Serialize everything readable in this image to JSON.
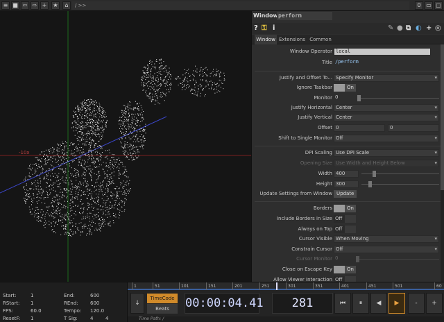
{
  "toolbar": {
    "path": "/ >>",
    "right_counter": "0"
  },
  "viewport": {
    "axis_label": "-10x",
    "colors": {
      "grid_red": "#8a2020",
      "grid_green": "#1d6b1d",
      "grid_blue": "#3b46c8"
    }
  },
  "panel": {
    "op_type": "Window",
    "op_name": "perform",
    "icons": [
      "help-icon",
      "python-help-icon",
      "info-icon",
      "pencil-icon",
      "comment-icon",
      "copy-icon",
      "refresh-icon",
      "plus-icon",
      "target-icon"
    ],
    "tabs": [
      "Window",
      "Extensions",
      "Common"
    ],
    "params": {
      "window_operator": {
        "label": "Window Operator",
        "value": "local"
      },
      "title": {
        "label": "Title",
        "value": "/perform"
      },
      "justify_offset": {
        "label": "Justify and Offset To...",
        "value": "Specify Monitor"
      },
      "ignore_taskbar": {
        "label": "Ignore Taskbar",
        "value": "On"
      },
      "monitor": {
        "label": "Monitor",
        "value": "0"
      },
      "justify_h": {
        "label": "Justify Horizontal",
        "value": "Center"
      },
      "justify_v": {
        "label": "Justify Vertical",
        "value": "Center"
      },
      "offset": {
        "label": "Offset",
        "value_x": "0",
        "value_y": "0"
      },
      "shift_single": {
        "label": "Shift to Single Monitor",
        "value": "Off"
      },
      "dpi_scaling": {
        "label": "DPI Scaling",
        "value": "Use DPI Scale"
      },
      "opening_size": {
        "label": "Opening Size",
        "value": "Use Width and Height Below"
      },
      "width": {
        "label": "Width",
        "value": "400"
      },
      "height": {
        "label": "Height",
        "value": "300"
      },
      "update_settings": {
        "label": "Update Settings from Window",
        "button": "Update"
      },
      "borders": {
        "label": "Borders",
        "value": "On"
      },
      "include_borders": {
        "label": "Include Borders in Size",
        "value": "Off"
      },
      "always_on_top": {
        "label": "Always on Top",
        "value": "Off"
      },
      "cursor_visible": {
        "label": "Cursor Visible",
        "value": "When Moving"
      },
      "constrain_cursor": {
        "label": "Constrain Cursor",
        "value": "Off"
      },
      "cursor_monitor": {
        "label": "Cursor Monitor",
        "value": "0"
      },
      "close_escape": {
        "label": "Close on Escape Key",
        "value": "On"
      },
      "allow_viewer": {
        "label": "Allow Viewer Interaction",
        "value": "Off"
      }
    }
  },
  "timeline": {
    "ticks": [
      "1",
      "51",
      "101",
      "151",
      "201",
      "251",
      "301",
      "351",
      "401",
      "451",
      "501",
      "60"
    ]
  },
  "stats": {
    "start_label": "Start:",
    "start": "1",
    "end_label": "End:",
    "end": "600",
    "rstart_label": "RStart:",
    "rstart": "1",
    "rend_label": "REnd:",
    "rend": "600",
    "fps_label": "FPS:",
    "fps": "60.0",
    "tempo_label": "Tempo:",
    "tempo": "120.0",
    "resetf_label": "ResetF:",
    "resetf": "1",
    "tsig_label": "T Sig:",
    "tsig_a": "4",
    "tsig_b": "4"
  },
  "transport": {
    "timecode_mode": "TimeCode",
    "beats_mode": "Beats",
    "timecode": "00:00:04.41",
    "frame": "281",
    "minus": "-",
    "plus": "+"
  },
  "status": {
    "time_path": "Time Path: /"
  }
}
